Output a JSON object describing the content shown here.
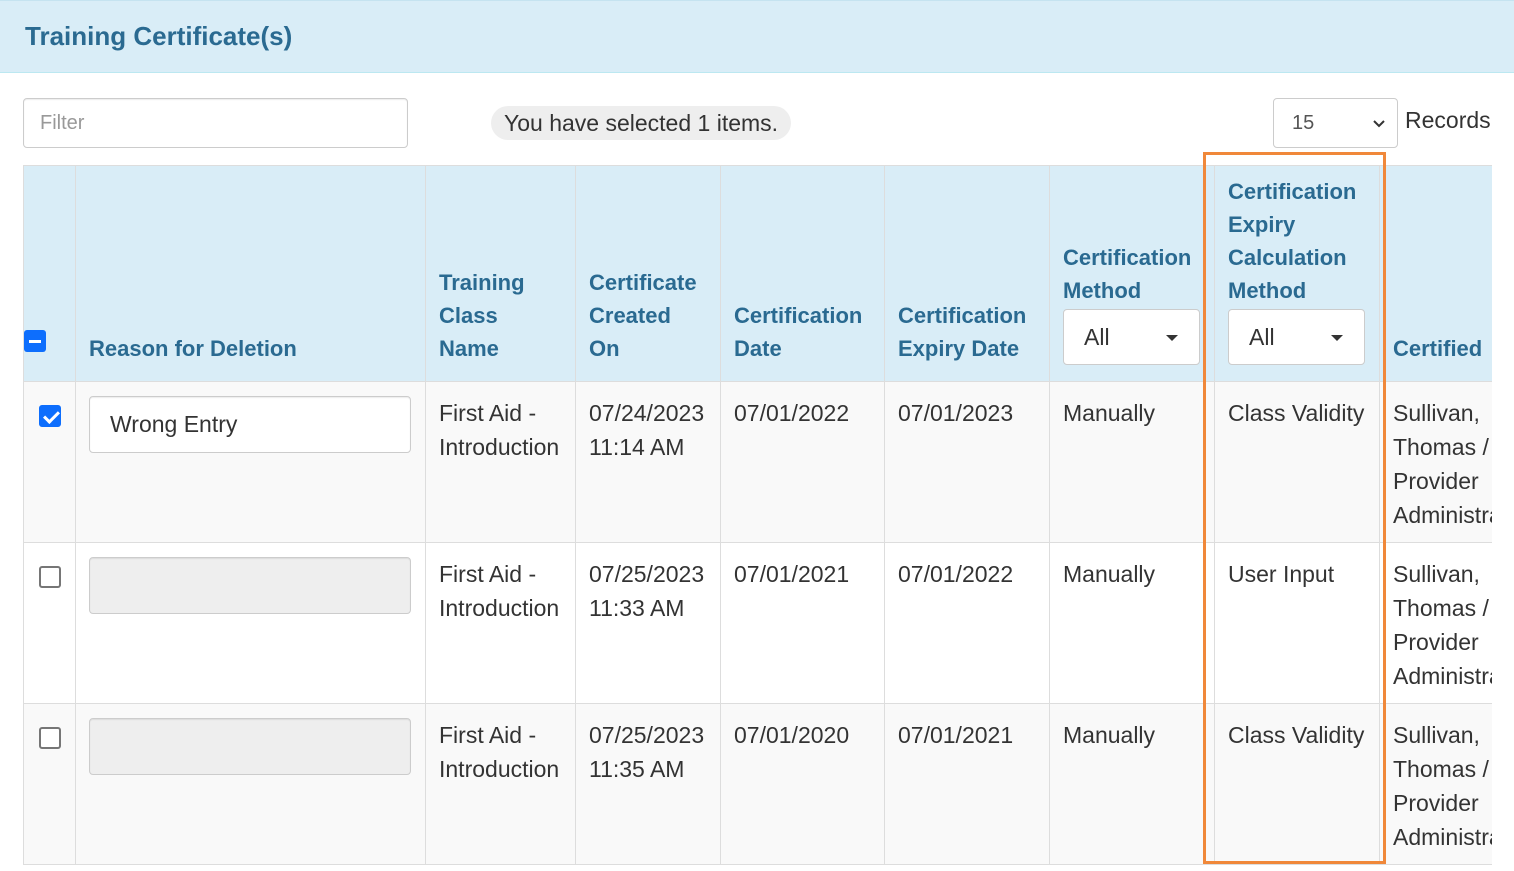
{
  "panel": {
    "title": "Training Certificate(s)"
  },
  "toolbar": {
    "filter_placeholder": "Filter",
    "selection_text": "You have selected 1 items.",
    "records_value": "15",
    "records_label": "Records"
  },
  "table": {
    "headers": {
      "reason": "Reason for Deletion",
      "class_name": "Training Class Name",
      "created_on": "Certificate Created On",
      "cert_date": "Certification Date",
      "expiry_date": "Certification Expiry Date",
      "method": "Certification Method",
      "method_filter": "All",
      "calc_method": "Certification Expiry Calculation Method",
      "calc_method_filter": "All",
      "certified": "Certified"
    },
    "rows": [
      {
        "checked": true,
        "reason": "Wrong Entry",
        "class_name": "First Aid - Introduction",
        "created_on": "07/24/2023 11:14 AM",
        "cert_date": "07/01/2022",
        "expiry_date": "07/01/2023",
        "method": "Manually",
        "calc_method": "Class Validity",
        "certified": "Sullivan, Thomas / Provider Administrator"
      },
      {
        "checked": false,
        "reason": "",
        "class_name": "First Aid - Introduction",
        "created_on": "07/25/2023 11:33 AM",
        "cert_date": "07/01/2021",
        "expiry_date": "07/01/2022",
        "method": "Manually",
        "calc_method": "User Input",
        "certified": "Sullivan, Thomas / Provider Administrator"
      },
      {
        "checked": false,
        "reason": "",
        "class_name": "First Aid - Introduction",
        "created_on": "07/25/2023 11:35 AM",
        "cert_date": "07/01/2020",
        "expiry_date": "07/01/2021",
        "method": "Manually",
        "calc_method": "Class Validity",
        "certified": "Sullivan, Thomas / Provider Administrator"
      }
    ]
  },
  "colors": {
    "header_bg": "#d9edf7",
    "header_text": "#2a6a91",
    "checkbox_blue": "#0d6efd",
    "highlight_orange": "#f0883a"
  },
  "icons": {
    "records_dropdown": "chevron-down-icon",
    "filter_dropdown": "caret-down-icon"
  }
}
